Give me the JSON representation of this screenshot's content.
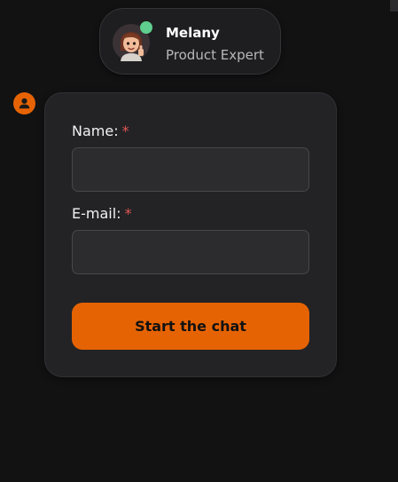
{
  "colors": {
    "background": "#121213",
    "card_background": "#232325",
    "accent": "#e66303",
    "online_status": "#5fce8e",
    "required_marker": "#e35656"
  },
  "agent": {
    "name": "Melany",
    "role": "Product Expert",
    "avatar_icon": "memoji-avatar-icon",
    "status": "online"
  },
  "user_icon": "user-avatar-icon",
  "form": {
    "name_label": "Name:",
    "name_required": "*",
    "name_value": "",
    "email_label": "E-mail:",
    "email_required": "*",
    "email_value": "",
    "submit_label": "Start the chat"
  }
}
